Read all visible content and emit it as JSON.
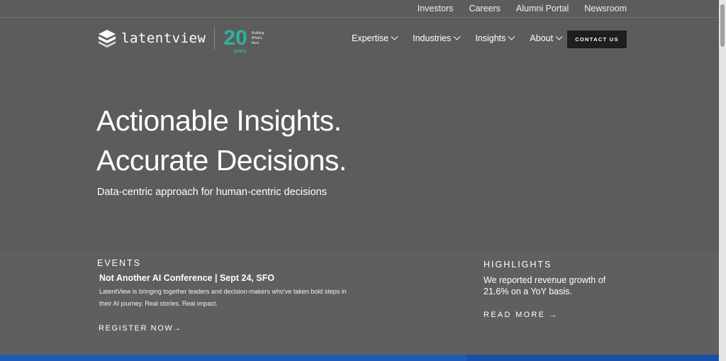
{
  "top_links": [
    "Investors",
    "Careers",
    "Alumni Portal",
    "Newsroom"
  ],
  "logo": {
    "text": "latentview",
    "anniversary_number": "20",
    "anniversary_unit": "years",
    "tagline_1": "Building",
    "tagline_2": "What's",
    "tagline_3": "Next"
  },
  "nav": [
    {
      "label": "Expertise"
    },
    {
      "label": "Industries"
    },
    {
      "label": "Insights"
    },
    {
      "label": "About"
    }
  ],
  "contact_label": "CONTACT US",
  "hero": {
    "line1": "Actionable Insights.",
    "line2": "Accurate Decisions.",
    "subtitle": "Data-centric approach for human-centric decisions"
  },
  "events": {
    "label": "EVENTS",
    "title": "Not Another AI Conference | Sept 24, SFO",
    "description": "LatentView is bringing together leaders and decision-makers who've taken bold steps in their AI journey. Real stories. Real impact.",
    "cta": "REGISTER NOW→"
  },
  "highlights": {
    "label": "HIGHLIGHTS",
    "text": "We reported revenue growth of 21.6% on a YoY basis.",
    "cta": "READ MORE →"
  },
  "colors": {
    "background": "#5c5c5c",
    "accent_teal": "#2bb3a3",
    "button_dark": "#1e1e1e",
    "strip_blue": "#1d5bb5"
  }
}
